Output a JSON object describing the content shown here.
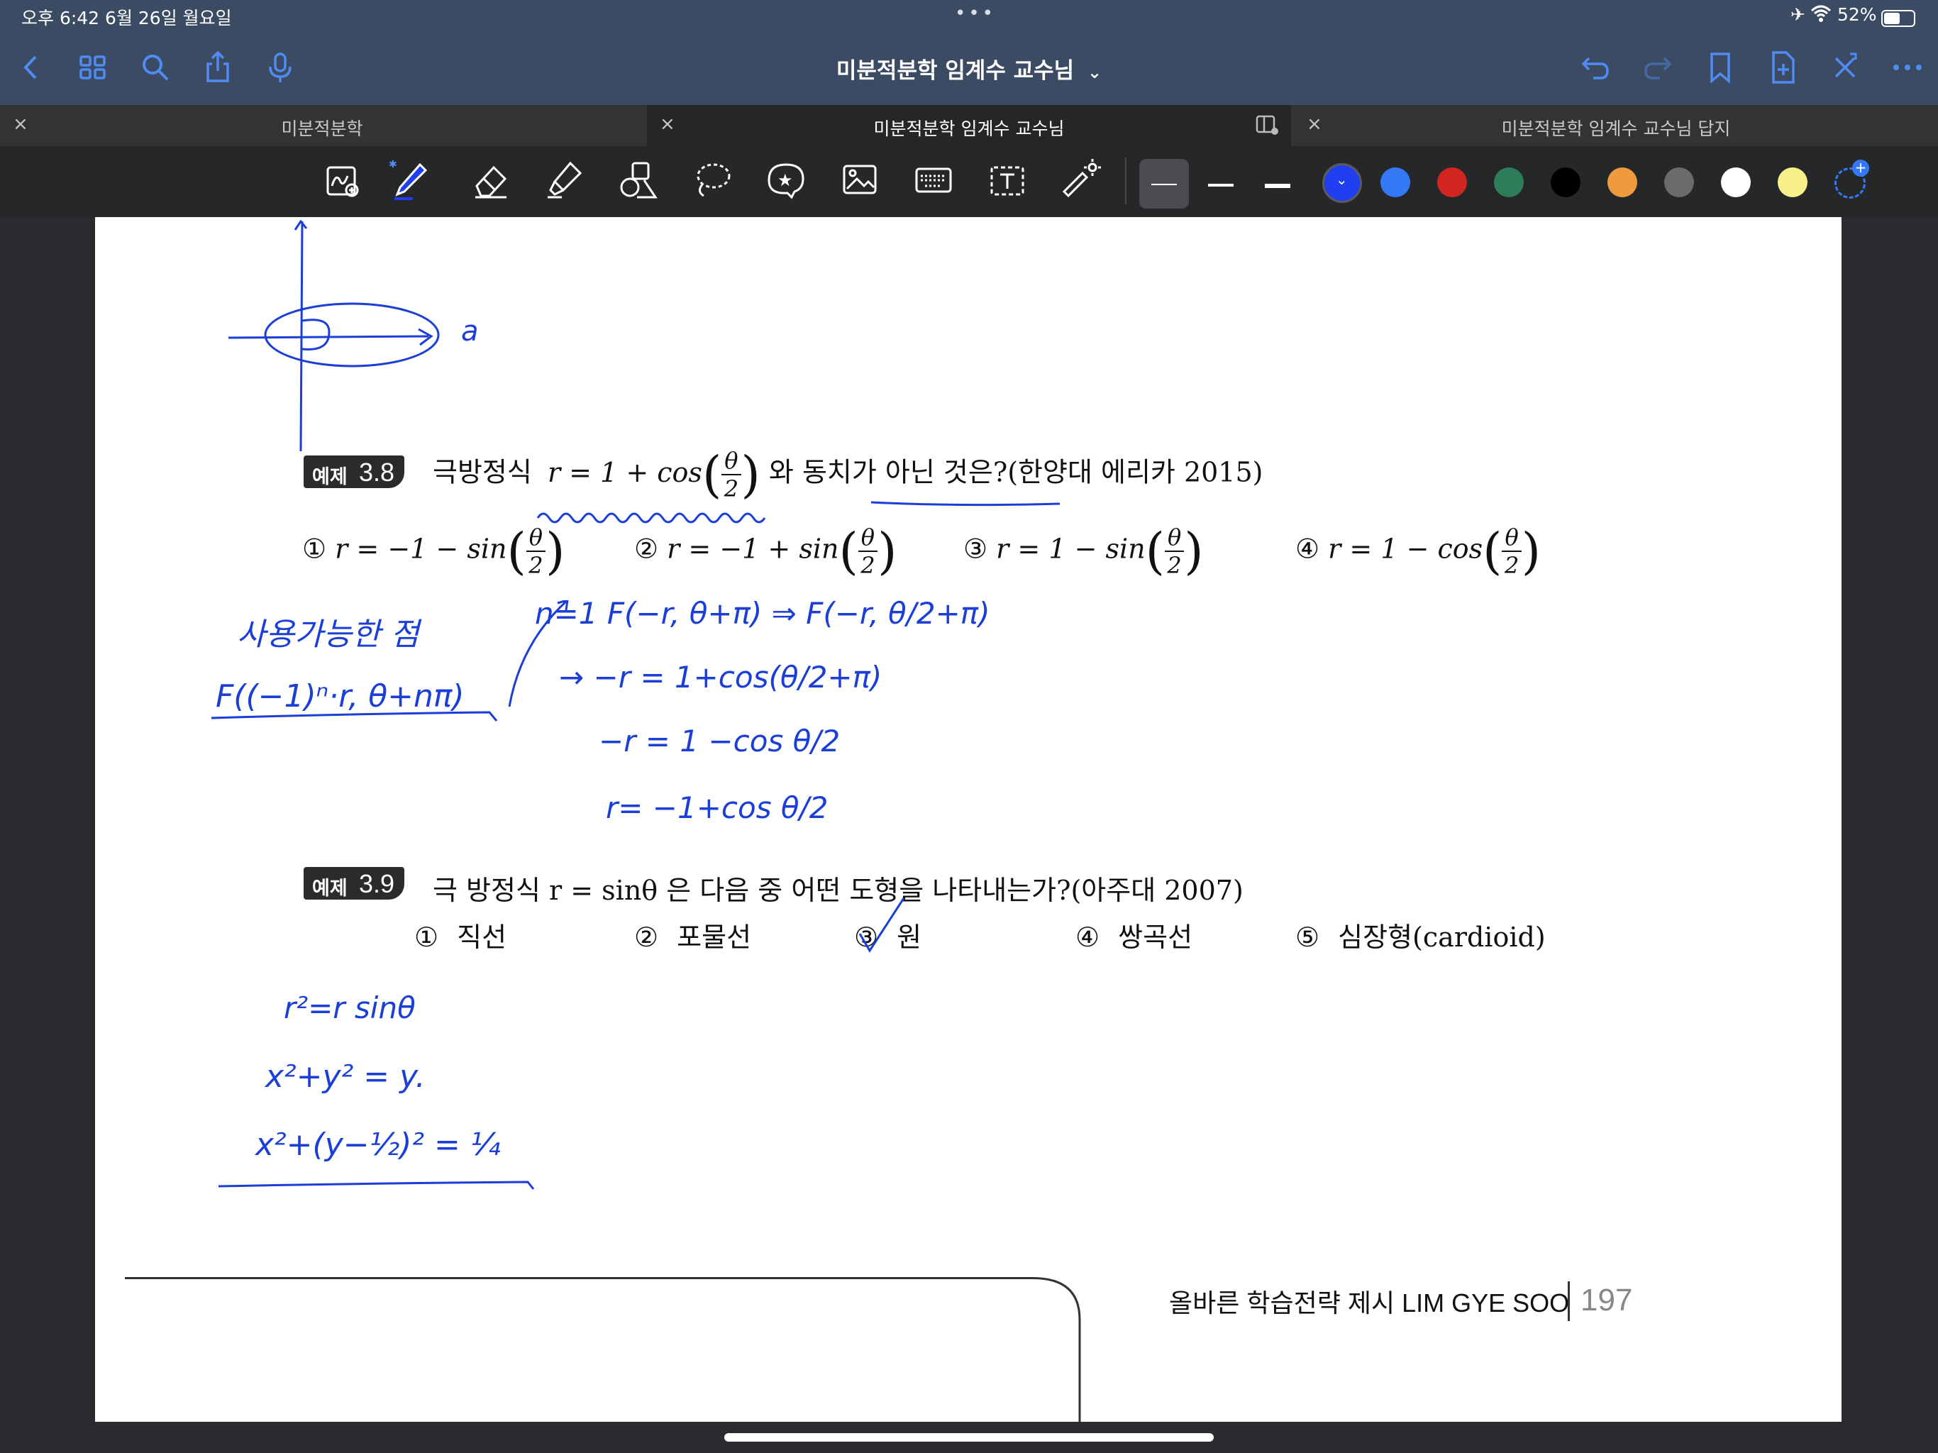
{
  "status": {
    "time_date": "오후 6:42   6월 26일 월요일",
    "battery": "52%"
  },
  "title_bar": {
    "title": "미분적분학 임계수 교수님",
    "title_chevron": "⌄"
  },
  "tabs": [
    {
      "label": "미분적분학",
      "close": "×"
    },
    {
      "label": "미분적분학 임계수 교수님",
      "close": "×"
    },
    {
      "label": "미분적분학 임계수 교수님 답지",
      "close": "×"
    }
  ],
  "colors": {
    "accent": "#4f8bf0",
    "swatches": [
      "#1f3ff0",
      "#3478f6",
      "#d0261f",
      "#2e7d5a",
      "#000000",
      "#f09a3e",
      "#6b6b6b",
      "#ffffff",
      "#f8f08a"
    ],
    "ink": "#1b3fd6"
  },
  "icons": {
    "nav_left": [
      "back-chevron-icon",
      "grid-icon",
      "search-icon",
      "share-icon",
      "microphone-icon"
    ],
    "nav_right": [
      "undo-icon",
      "redo-icon",
      "bookmark-icon",
      "add-page-icon",
      "close-x-icon",
      "more-icon"
    ],
    "tools": [
      "zoom-box-icon",
      "pen-icon",
      "eraser-icon",
      "highlighter-icon",
      "shapes-icon",
      "lasso-icon",
      "sticker-icon",
      "image-icon",
      "keyboard-icon",
      "text-box-icon",
      "laser-pointer-icon"
    ]
  },
  "q38": {
    "badge_label": "예제",
    "badge_num": "3.8",
    "stem_prefix": "극방정식",
    "stem_eq": "r = 1 + cos",
    "stem_suffix": "와 동치가 아닌 것은?(한양대 에리카 2015)",
    "theta": "θ",
    "two": "2",
    "options": [
      {
        "num": "①",
        "eq": "r = −1 − sin"
      },
      {
        "num": "②",
        "eq": "r = −1 + sin"
      },
      {
        "num": "③",
        "eq": "r = 1 − sin"
      },
      {
        "num": "④",
        "eq": "r = 1 − cos"
      }
    ]
  },
  "q39": {
    "badge_label": "예제",
    "badge_num": "3.9",
    "stem": "극 방정식 r = sinθ 은 다음 중 어떤 도형을 나타내는가?(아주대 2007)",
    "options": [
      {
        "num": "①",
        "text": "직선"
      },
      {
        "num": "②",
        "text": "포물선"
      },
      {
        "num": "③",
        "text": "원"
      },
      {
        "num": "④",
        "text": "쌍곡선"
      },
      {
        "num": "⑤",
        "text": "심장형(cardioid)"
      }
    ]
  },
  "handwriting": {
    "axis_label": "a",
    "note1": "사용가능한 점",
    "note2": "F((−1)ⁿ·r, θ+nπ)",
    "line1": "n=1   F(−r, θ+π) ⇒ F(−r, θ/2+π)",
    "line2": "→  −r = 1+cos(θ/2+π)",
    "line3": "−r = 1 −cos θ/2",
    "line4": "r= −1+cos θ/2",
    "note3": "r²=r sinθ",
    "note4": "x²+y² = y.",
    "note5": "x²+(y−½)² = ¼"
  },
  "footer": {
    "slogan": "올바른  학습전략  제시  LIM  GYE  SOO",
    "page_num": "197"
  }
}
